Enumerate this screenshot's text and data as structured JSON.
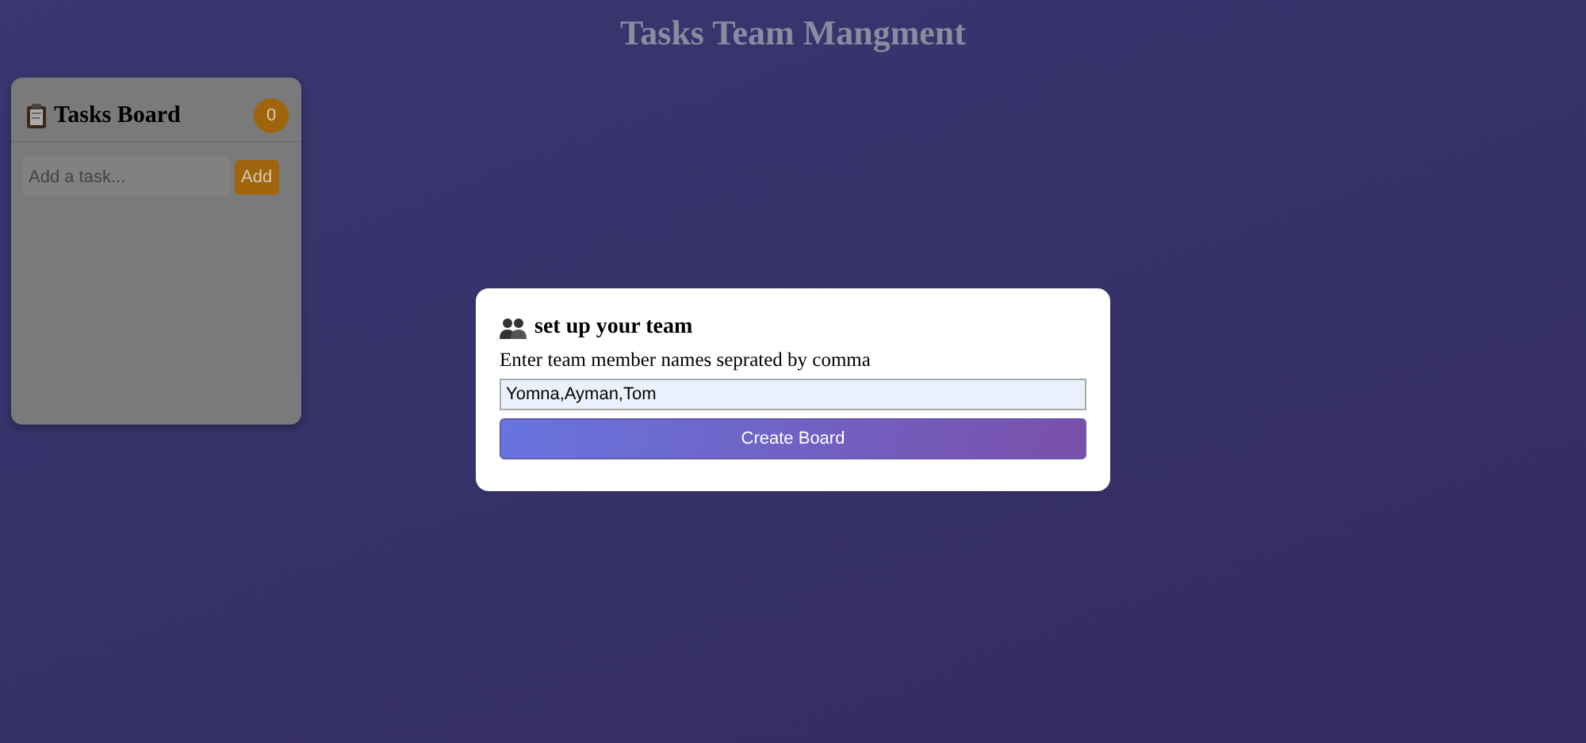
{
  "header": {
    "title": "Tasks Team Mangment"
  },
  "board": {
    "title": "Tasks Board",
    "count": "0",
    "task_input": {
      "placeholder": "Add a task..."
    },
    "add_button": "Add"
  },
  "dialog": {
    "title": "set up your team",
    "prompt": "Enter team member names seprated by comma",
    "names_input": {
      "value": "Yomna,Ayman,Tom"
    },
    "create_button": "Create Board"
  }
}
